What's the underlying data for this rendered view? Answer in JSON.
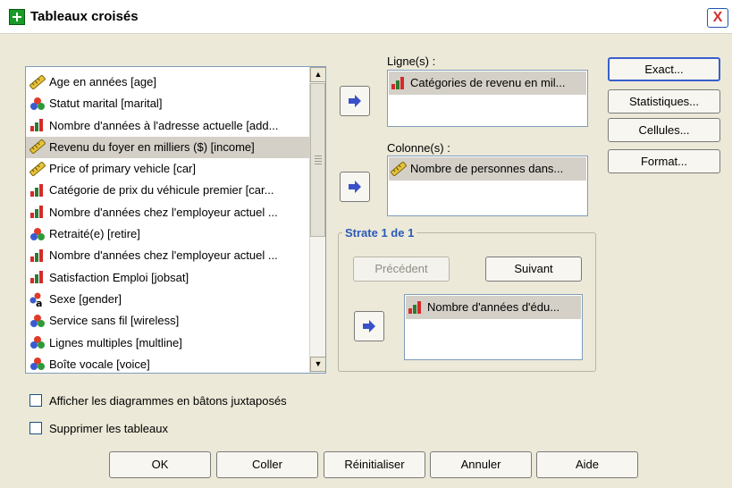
{
  "window": {
    "title": "Tableaux croisés",
    "close_glyph": "X"
  },
  "variables": [
    {
      "label": "Age en années [age]",
      "icon": "scale-icon"
    },
    {
      "label": "Statut marital [marital]",
      "icon": "nominal-icon"
    },
    {
      "label": "Nombre d'années à l'adresse actuelle [add...",
      "icon": "ordinal-icon"
    },
    {
      "label": "Revenu du foyer en milliers ($) [income]",
      "icon": "scale-icon",
      "selected": true
    },
    {
      "label": "Price of primary vehicle [car]",
      "icon": "scale-icon"
    },
    {
      "label": "Catégorie de prix du véhicule premier [car...",
      "icon": "ordinal-icon"
    },
    {
      "label": "Nombre d'années chez l'employeur actuel ...",
      "icon": "ordinal-icon"
    },
    {
      "label": "Retraité(e) [retire]",
      "icon": "nominal-icon"
    },
    {
      "label": "Nombre d'années chez l'employeur actuel ...",
      "icon": "ordinal-icon"
    },
    {
      "label": "Satisfaction Emploi [jobsat]",
      "icon": "ordinal-icon"
    },
    {
      "label": "Sexe [gender]",
      "icon": "nominal-string-icon"
    },
    {
      "label": "Service sans fil [wireless]",
      "icon": "nominal-icon"
    },
    {
      "label": "Lignes multiples [multline]",
      "icon": "nominal-icon"
    },
    {
      "label": "Boîte vocale [voice]",
      "icon": "nominal-icon"
    }
  ],
  "rows": {
    "label": "Ligne(s) :",
    "items": [
      "Catégories de revenu en mil..."
    ]
  },
  "columns": {
    "label": "Colonne(s) :",
    "items": [
      "Nombre de personnes dans..."
    ]
  },
  "layer": {
    "title": "Strate 1 de 1",
    "previous_label": "Précédent",
    "next_label": "Suivant",
    "items": [
      "Nombre d'années d'édu..."
    ]
  },
  "side_buttons": {
    "exact": "Exact...",
    "statistics": "Statistiques...",
    "cells": "Cellules...",
    "format": "Format..."
  },
  "options": {
    "clustered_bar_label": "Afficher les diagrammes en bâtons juxtaposés",
    "clustered_bar_checked": false,
    "suppress_tables_label": "Supprimer les tableaux",
    "suppress_tables_checked": false
  },
  "bottom_buttons": {
    "ok": "OK",
    "paste": "Coller",
    "reset": "Réinitialiser",
    "cancel": "Annuler",
    "help": "Aide"
  },
  "colors": {
    "dialog_bg": "#ece9d8",
    "selection_bg": "#d4d0c8",
    "arrow_blue": "#3a50c8",
    "group_title_blue": "#2a5ab8",
    "close_red": "#d03030"
  }
}
